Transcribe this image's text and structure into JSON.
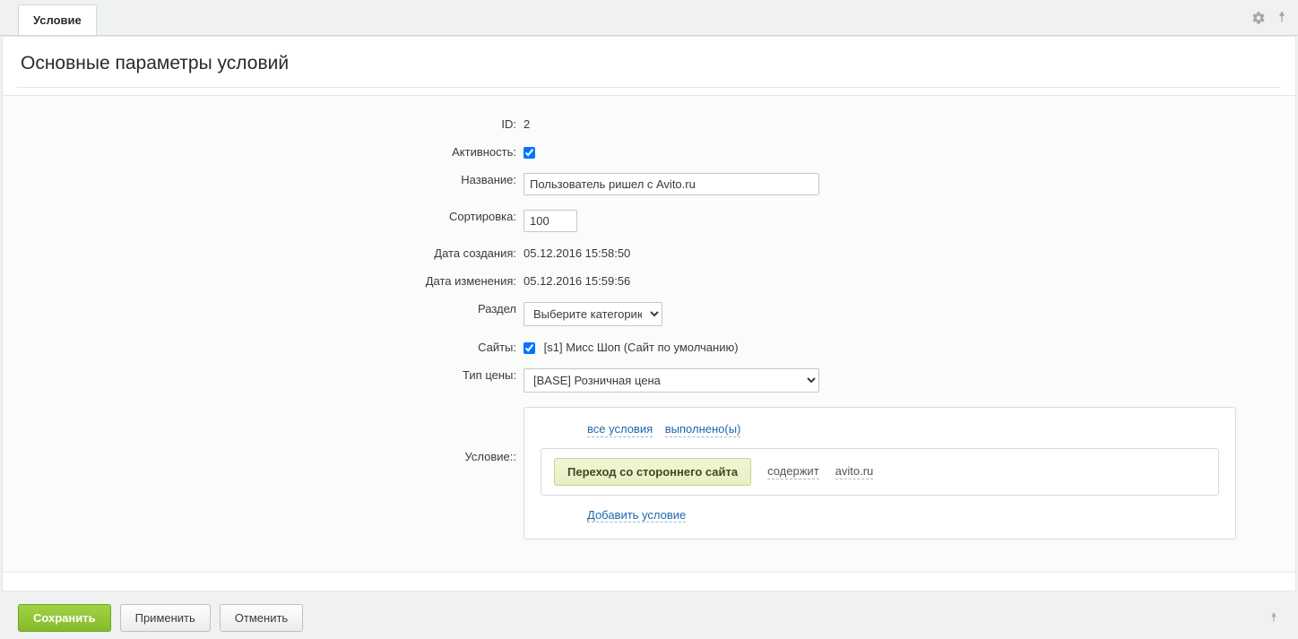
{
  "tab": {
    "label": "Условие"
  },
  "section_title": "Основные параметры условий",
  "fields": {
    "id": {
      "label": "ID:",
      "value": "2"
    },
    "active": {
      "label": "Активность:",
      "checked": true
    },
    "name": {
      "label": "Название:",
      "value": "Пользователь ришел с Avito.ru"
    },
    "sort": {
      "label": "Сортировка:",
      "value": "100"
    },
    "created": {
      "label": "Дата создания:",
      "value": "05.12.2016 15:58:50"
    },
    "modified": {
      "label": "Дата изменения:",
      "value": "05.12.2016 15:59:56"
    },
    "section": {
      "label": "Раздел",
      "placeholder": "Выберите категорию"
    },
    "sites": {
      "label": "Сайты:",
      "option": "[s1] Мисс Шоп (Сайт по умолчанию)",
      "checked": true
    },
    "price_type": {
      "label": "Тип цены:",
      "value": "[BASE] Розничная цена"
    },
    "condition": {
      "label": "Условие::"
    }
  },
  "condition_builder": {
    "all_link": "все условия",
    "done_link": "выполнено(ы)",
    "rule": {
      "chip": "Переход со стороннего сайта",
      "contains": "содержит",
      "value": "avito.ru"
    },
    "add_link": "Добавить условие"
  },
  "buttons": {
    "save": "Сохранить",
    "apply": "Применить",
    "cancel": "Отменить"
  }
}
